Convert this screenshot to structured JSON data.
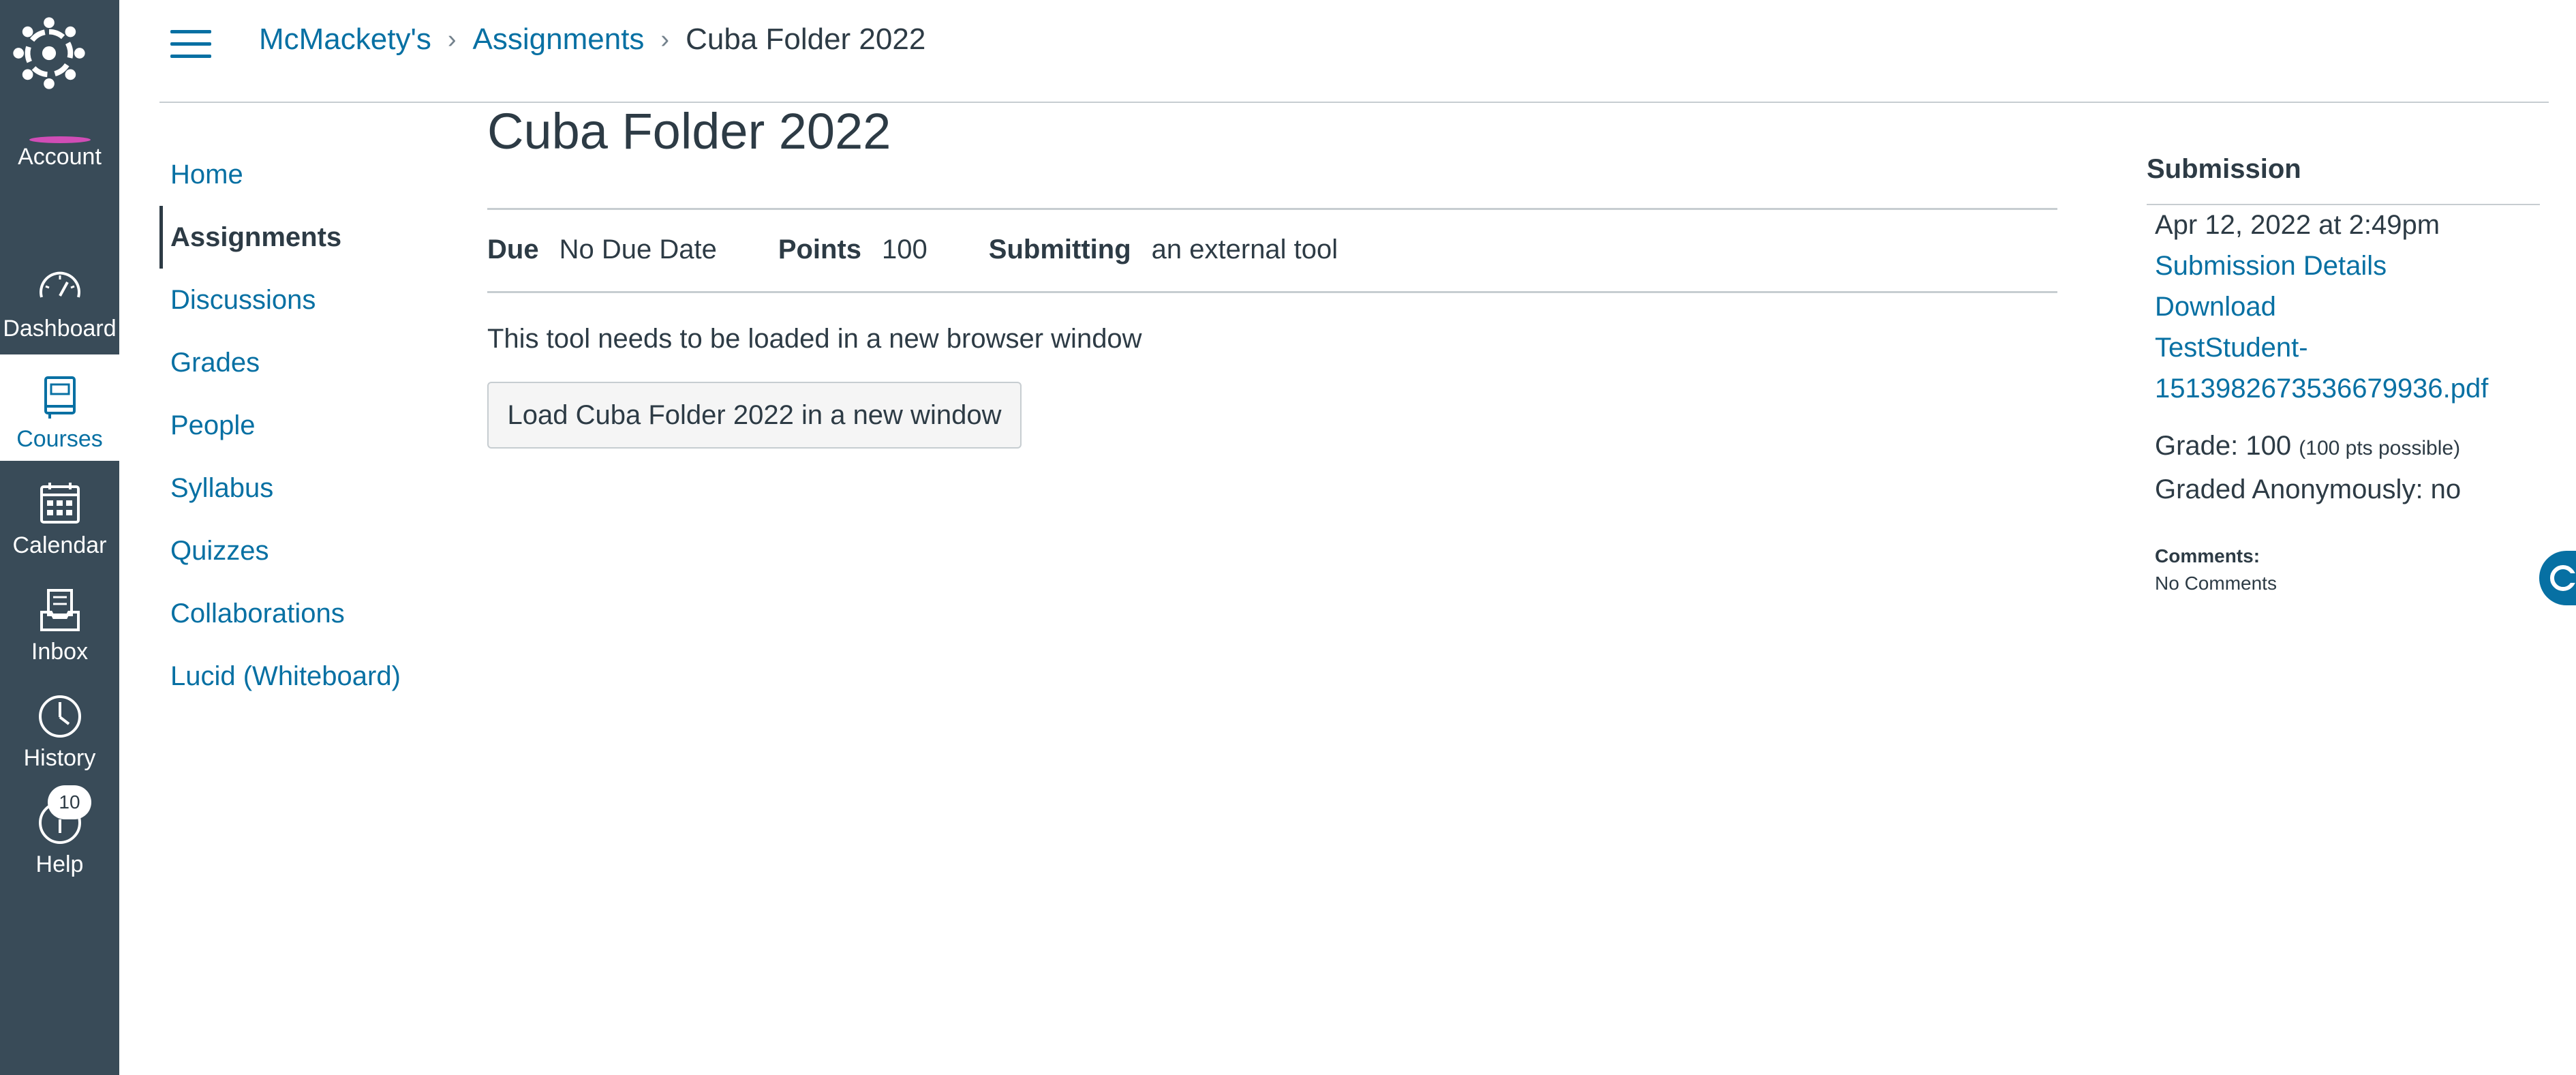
{
  "global_nav": {
    "items": [
      {
        "label": "Account",
        "icon": "avatar"
      },
      {
        "label": "Dashboard",
        "icon": "dashboard-icon"
      },
      {
        "label": "Courses",
        "icon": "courses-icon"
      },
      {
        "label": "Calendar",
        "icon": "calendar-icon"
      },
      {
        "label": "Inbox",
        "icon": "inbox-icon"
      },
      {
        "label": "History",
        "icon": "history-icon"
      },
      {
        "label": "Help",
        "icon": "help-icon"
      }
    ],
    "active": "Courses",
    "help_badge": "10",
    "colors": {
      "rail": "#394b58",
      "active_text": "#0770a3",
      "avatar_ring": "#d04db6"
    }
  },
  "breadcrumb": {
    "items": [
      "McMackety's",
      "Assignments",
      "Cuba Folder 2022"
    ],
    "separator": "›"
  },
  "course_nav": {
    "items": [
      "Home",
      "Assignments",
      "Discussions",
      "Grades",
      "People",
      "Syllabus",
      "Quizzes",
      "Collaborations",
      "Lucid (Whiteboard)"
    ],
    "active": "Assignments"
  },
  "assignment": {
    "title": "Cuba Folder 2022",
    "due_label": "Due",
    "due_value": "No Due Date",
    "points_label": "Points",
    "points_value": "100",
    "submitting_label": "Submitting",
    "submitting_value": "an external tool",
    "tool_message": "This tool needs to be loaded in a new browser window",
    "load_button": "Load Cuba Folder 2022 in a new window"
  },
  "submission": {
    "heading": "Submission",
    "date": "Apr 12, 2022 at 2:49pm",
    "details_link": "Submission Details",
    "download_link": "Download",
    "file_line1": "TestStudent-",
    "file_line2": "1513982673536679936.pdf",
    "grade_label": "Grade: 100",
    "grade_possible": "(100 pts possible)",
    "anonymous": "Graded Anonymously: no",
    "comments_label": "Comments:",
    "comments_value": "No Comments"
  },
  "accent_color": "#0770a3"
}
